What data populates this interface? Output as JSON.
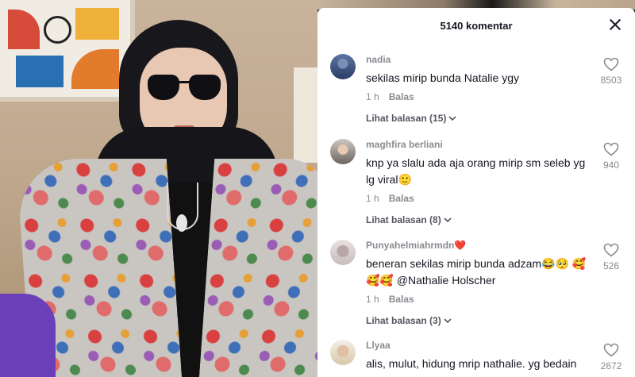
{
  "panel": {
    "title": "5140 komentar"
  },
  "comments": [
    {
      "username": "nadia",
      "text": "sekilas mirip bunda Natalie ygy",
      "time": "1 h",
      "reply_label": "Balas",
      "view_replies": "Lihat balasan (15)",
      "likes": "8503"
    },
    {
      "username": "maghfira berliani",
      "text": "knp ya slalu ada aja orang mirip sm seleb yg lg viral🙂",
      "time": "1 h",
      "reply_label": "Balas",
      "view_replies": "Lihat balasan (8)",
      "likes": "940"
    },
    {
      "username": "Punyahelmiahrmdn❤️",
      "text": "beneran sekilas mirip bunda adzam😂🥺 🥰🥰🥰 @Nathalie Holscher",
      "time": "1 h",
      "reply_label": "Balas",
      "view_replies": "Lihat balasan (3)",
      "likes": "526"
    },
    {
      "username": "Llyaa",
      "text": "alis, mulut, hidung mrip nathalie. yg bedain",
      "likes": "2672"
    }
  ],
  "icons": {
    "close": "close-icon",
    "like": "heart-icon",
    "expand": "chevron-down-icon"
  },
  "colors": {
    "text_primary": "#161823",
    "text_secondary": "#8a8b91",
    "sheet_bg": "#ffffff"
  }
}
